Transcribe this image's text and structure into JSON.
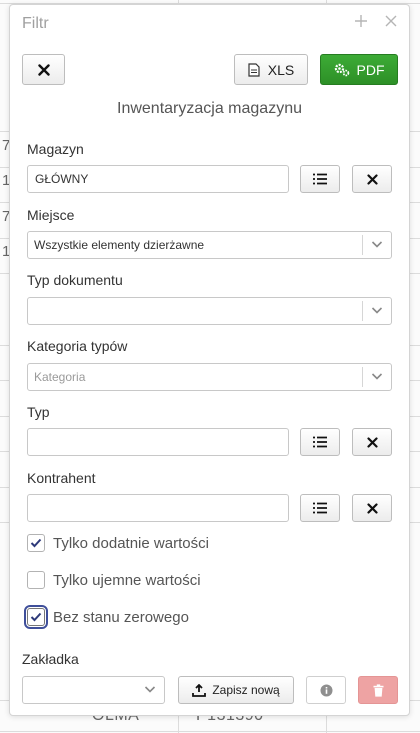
{
  "background": {
    "left_fragments": [
      "7",
      "1",
      "7",
      "1"
    ],
    "footer_cells": [
      "OLMA",
      "P131390"
    ]
  },
  "dialog": {
    "title": "Filtr",
    "header_icons": [
      "plus-icon",
      "close-icon"
    ]
  },
  "toolbar": {
    "xls_label": "XLS",
    "pdf_label": "PDF",
    "colors": {
      "pdf_button": "#2f9a29"
    }
  },
  "section_title": "Inwentaryzacja magazynu",
  "fields": {
    "magazyn": {
      "label": "Magazyn",
      "value": "GŁÓWNY"
    },
    "miejsce": {
      "label": "Miejsce",
      "value": "Wszystkie elementy dzierżawne"
    },
    "typ_dokumentu": {
      "label": "Typ dokumentu",
      "value": ""
    },
    "kategoria_typow": {
      "label": "Kategoria typów",
      "placeholder": "Kategoria"
    },
    "typ": {
      "label": "Typ",
      "value": ""
    },
    "kontrahent": {
      "label": "Kontrahent",
      "value": ""
    }
  },
  "checkboxes": [
    {
      "label": "Tylko dodatnie wartości",
      "checked": true
    },
    {
      "label": "Tylko ujemne wartości",
      "checked": false
    },
    {
      "label": "Bez stanu zerowego",
      "checked": true
    }
  ],
  "bookmark": {
    "label": "Zakładka",
    "value": "",
    "save_label": "Zapisz nową",
    "colors": {
      "delete_button": "#eea3a3"
    }
  }
}
